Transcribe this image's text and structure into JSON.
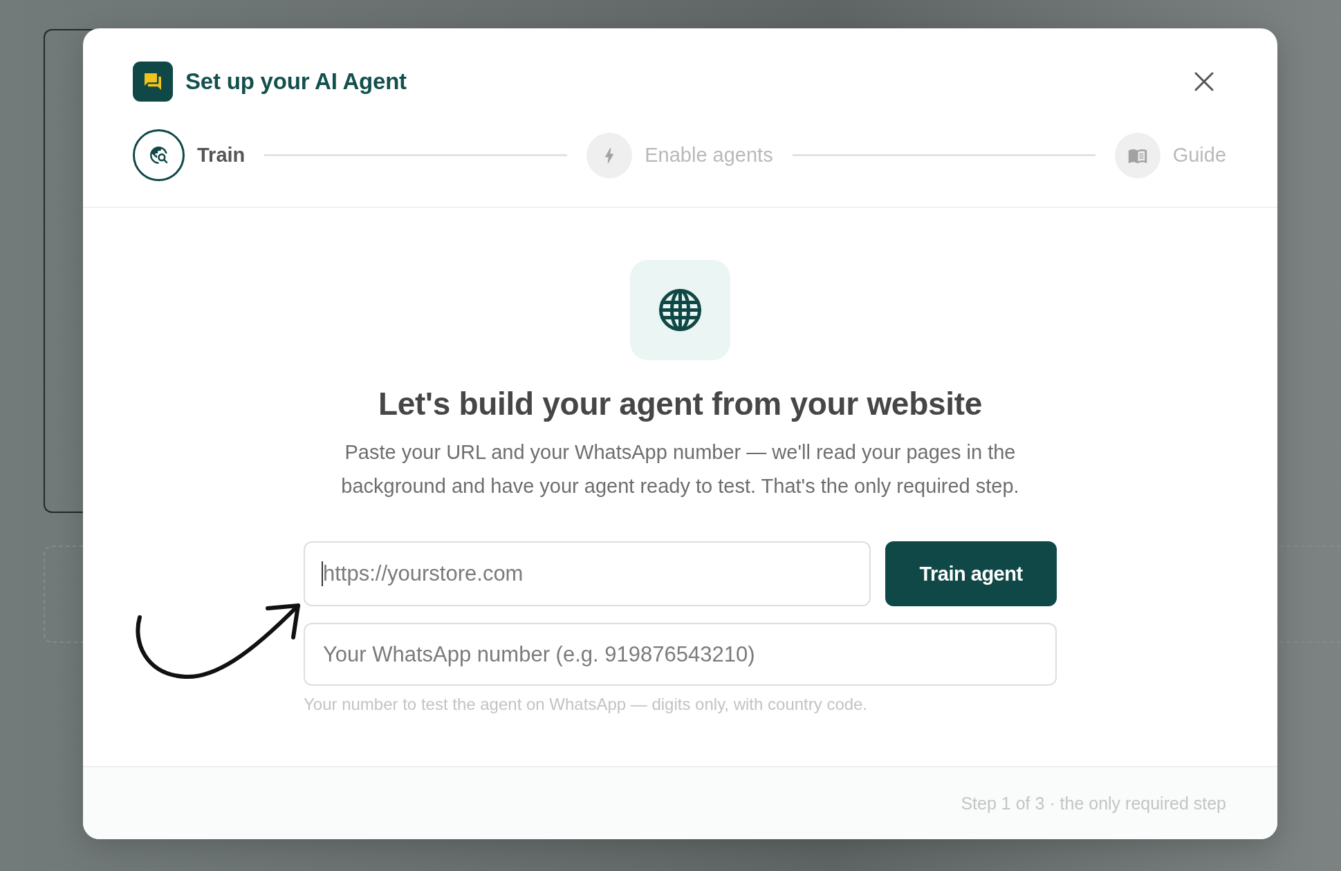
{
  "dialog": {
    "title": "Set up your AI Agent",
    "steps": [
      {
        "label": "Train",
        "active": true
      },
      {
        "label": "Enable agents",
        "active": false
      },
      {
        "label": "Guide",
        "active": false
      }
    ],
    "body": {
      "heading": "Let's build your agent from your website",
      "description": "Paste your URL and your WhatsApp number — we'll read your pages in the background and have your agent ready to test. That's the only required step.",
      "url_field": {
        "placeholder": "https://yourstore.com",
        "focused": true
      },
      "train_button": "Train agent",
      "phone_field": {
        "placeholder": "Your WhatsApp number (e.g. 919876543210)",
        "hint": "Your number to test the agent on WhatsApp — digits only, with country code."
      }
    },
    "footer": "Step 1 of 3 · the only required step"
  }
}
